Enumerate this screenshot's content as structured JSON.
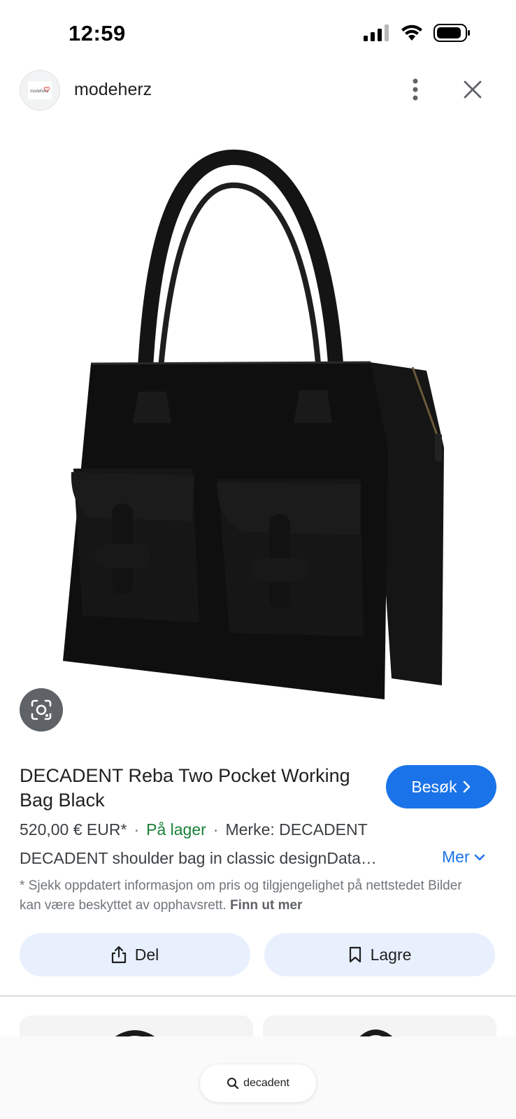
{
  "status_bar": {
    "time": "12:59",
    "icons": [
      "cellular-signal-icon",
      "wifi-icon",
      "battery-icon"
    ]
  },
  "header": {
    "site_name": "modeherz",
    "site_logo_text": "modeherz",
    "icons": [
      "more-vert-icon",
      "close-icon"
    ]
  },
  "product": {
    "image_alt": "black handbag with two front pockets",
    "title": "DECADENT Reba Two Pocket Working Bag Black",
    "visit_label": "Besøk",
    "price": "520,00 € EUR*",
    "stock": "På lager",
    "brand": "Merke: DECADENT",
    "description": "DECADENT shoulder bag in classic designData…",
    "more_label": "Mer",
    "disclaimer": "* Sjekk oppdatert informasjon om pris og tilgjengelighet på nettstedet Bilder kan være beskyttet av opphavsrett.",
    "learn_more": "Finn ut mer"
  },
  "actions": {
    "share_label": "Del",
    "save_label": "Lagre"
  },
  "bottom_search": {
    "query": "decadent"
  },
  "colors": {
    "accent": "#1a73e8",
    "stock_green": "#188038",
    "action_bg": "#e8f0fe"
  }
}
